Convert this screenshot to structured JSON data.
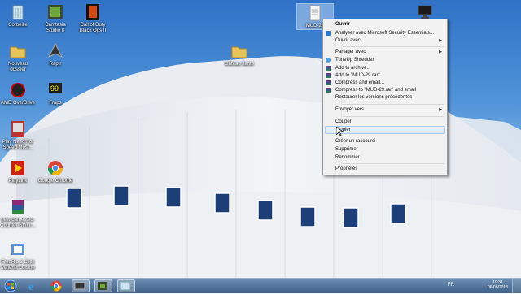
{
  "desktop_icons": [
    {
      "label": "Corbeille",
      "icon": "recycle-bin-icon"
    },
    {
      "label": "Camtasia Studio 8",
      "icon": "camtasia-icon"
    },
    {
      "label": "Call of Duty Black Ops II",
      "icon": "black-ops-icon"
    },
    {
      "label": "Nouveau dossier",
      "icon": "new-folder-icon"
    },
    {
      "label": "Raptr",
      "icon": "raptr-icon"
    },
    {
      "label": "AMD OverDrive",
      "icon": "amd-icon"
    },
    {
      "label": "Fraps",
      "icon": "fraps-icon"
    },
    {
      "label": "Play Need For Speed Most...",
      "icon": "nfs-icon"
    },
    {
      "label": "PlayLink",
      "icon": "playlink-icon"
    },
    {
      "label": "Google Chrome",
      "icon": "chrome-icon"
    },
    {
      "label": "new-games.eu-Counter-Strike...",
      "icon": "winrar-icon"
    },
    {
      "label": "FreeRip 3 Click Matériel cuisine",
      "icon": "installer-icon"
    },
    {
      "label": "Gâteau flanté",
      "icon": "folder-icon"
    },
    {
      "label": "MUD-29",
      "icon": "file-icon"
    },
    {
      "label": "",
      "icon": "monitor-icon"
    }
  ],
  "context_menu": {
    "items": [
      {
        "label": "Ouvrir",
        "bold": true,
        "icon": ""
      },
      {
        "label": "Analyser avec Microsoft Security Essentials...",
        "icon": "security-essentials-icon"
      },
      {
        "label": "Ouvrir avec",
        "submenu": true,
        "icon": ""
      },
      {
        "label": "Partager avec",
        "submenu": true,
        "icon": ""
      },
      {
        "label": "TuneUp Shredder",
        "icon": "tuneup-icon"
      },
      {
        "label": "Add to archive...",
        "icon": "winrar-icon"
      },
      {
        "label": "Add to \"MUD-29.rar\"",
        "icon": "winrar-icon"
      },
      {
        "label": "Compress and email...",
        "icon": "winrar-icon"
      },
      {
        "label": "Compress to \"MUD-29.rar\" and email",
        "icon": "winrar-icon"
      },
      {
        "label": "Restaurer les versions précédentes",
        "icon": ""
      },
      {
        "label": "Envoyer vers",
        "submenu": true,
        "icon": ""
      },
      {
        "label": "Couper",
        "icon": ""
      },
      {
        "label": "Copier",
        "icon": "",
        "hover": true
      },
      {
        "label": "Créer un raccourci",
        "icon": ""
      },
      {
        "label": "Supprimer",
        "icon": ""
      },
      {
        "label": "Renommer",
        "icon": ""
      },
      {
        "label": "Propriétés",
        "icon": ""
      }
    ],
    "submenu_arrow": "▶"
  },
  "taskbar": {
    "buttons": [
      {
        "name": "start-orb-icon"
      },
      {
        "name": "internet-explorer-icon"
      },
      {
        "name": "chrome-icon"
      },
      {
        "name": "app-taskbar-icon"
      },
      {
        "name": "camtasia-taskbar-icon"
      },
      {
        "name": "app-window-taskbar-icon"
      }
    ],
    "language": "FR",
    "time": "19:31",
    "date": "06/08/2013"
  },
  "colors": {
    "sky": "#3c82d2",
    "menu_bg": "#f2f2f2",
    "taskbar": "#4a6a92"
  }
}
